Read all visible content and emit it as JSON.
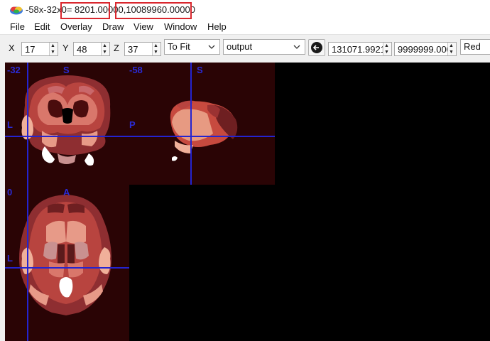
{
  "titlebar": {
    "title_prefix": "-58x-32x0",
    "value1": "= 8201.0000",
    "value1_tail": "0,",
    "value2": "10089960.00000",
    "icon": "mricron-brain-icon"
  },
  "menu": [
    "File",
    "Edit",
    "Overlay",
    "Draw",
    "View",
    "Window",
    "Help"
  ],
  "toolbar": {
    "x_label": "X",
    "x_value": "17",
    "y_label": "Y",
    "y_value": "48",
    "z_label": "Z",
    "z_value": "37",
    "zoom_value": "To Fit",
    "layer_value": "output",
    "min_value": "131071.9921",
    "max_value": "9999999.000",
    "colormap_value": "Red"
  },
  "views": {
    "coronal": {
      "coord": "-32",
      "top": "S",
      "side": "L"
    },
    "sagittal": {
      "coord": "-58",
      "top": "S",
      "side": "P"
    },
    "axial": {
      "coord": "0",
      "top": "A",
      "side": "L"
    }
  },
  "colors": {
    "crosshair": "#2424d0",
    "label": "#2b2bd6",
    "highlight": "#d9272e",
    "slice_bg": "#2a0405"
  }
}
